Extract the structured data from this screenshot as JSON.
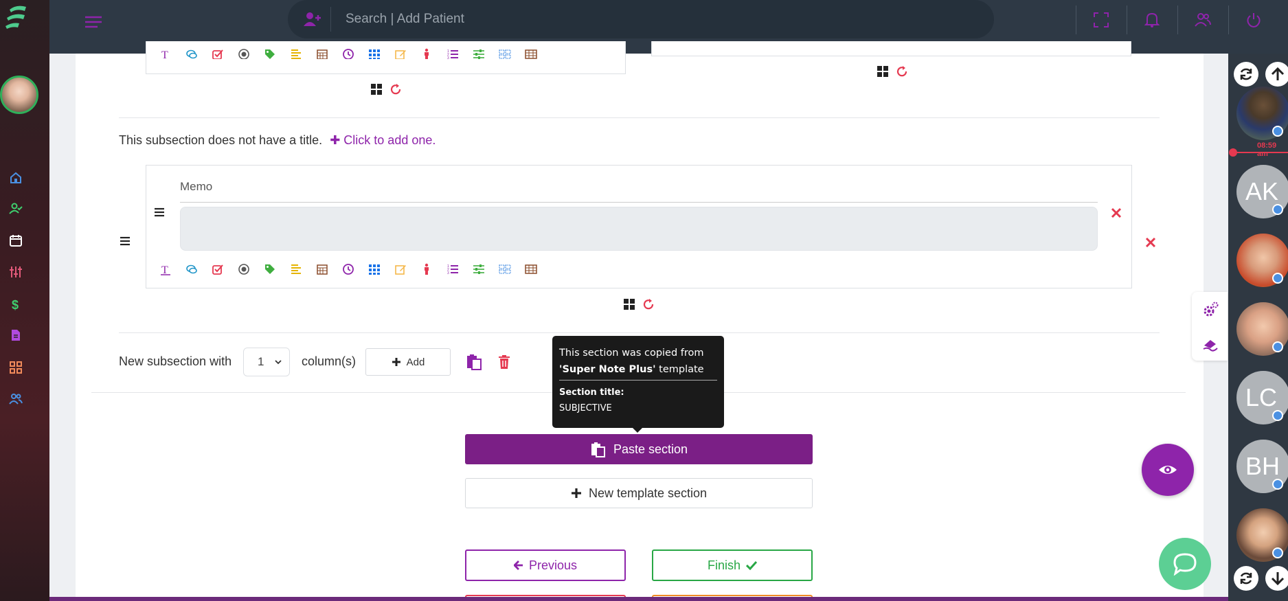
{
  "topbar": {
    "search_placeholder": "Search | Add Patient"
  },
  "editor": {
    "subsection_notice": "This subsection does not have a title.",
    "add_title_link": "Click to add one.",
    "memo_label": "Memo",
    "new_subsection_label": "New subsection with",
    "columns_value": "1",
    "columns_label": "column(s)",
    "add_button": "Add"
  },
  "tooltip": {
    "line1": "This section was copied from",
    "template_name": "'Super Note Plus'",
    "template_suffix": " template",
    "section_title_label": "Section title:",
    "section_title_value": "SUBJECTIVE"
  },
  "actions": {
    "paste_section": "Paste section",
    "new_template_section": "New template section",
    "previous": "Previous",
    "finish": "Finish"
  },
  "right_strip": {
    "time": "08:59 am",
    "patients": [
      {
        "type": "photo"
      },
      {
        "type": "initials",
        "initials": "AK"
      },
      {
        "type": "photo"
      },
      {
        "type": "photo"
      },
      {
        "type": "initials",
        "initials": "LC"
      },
      {
        "type": "initials",
        "initials": "BH"
      },
      {
        "type": "photo"
      }
    ]
  },
  "toolbar_icons": [
    "text-icon",
    "comment-icon",
    "checkbox-icon",
    "radio-icon",
    "tag-icon",
    "align-icon",
    "calendar-icon",
    "clock-icon",
    "grid-icon",
    "edit-icon",
    "body-icon",
    "list-icon",
    "sliders-icon",
    "dotted-grid-icon",
    "table-icon"
  ],
  "colors": {
    "accent": "#8e24aa",
    "topbar": "#2e3945",
    "success": "#28a745",
    "danger": "#e53950"
  }
}
